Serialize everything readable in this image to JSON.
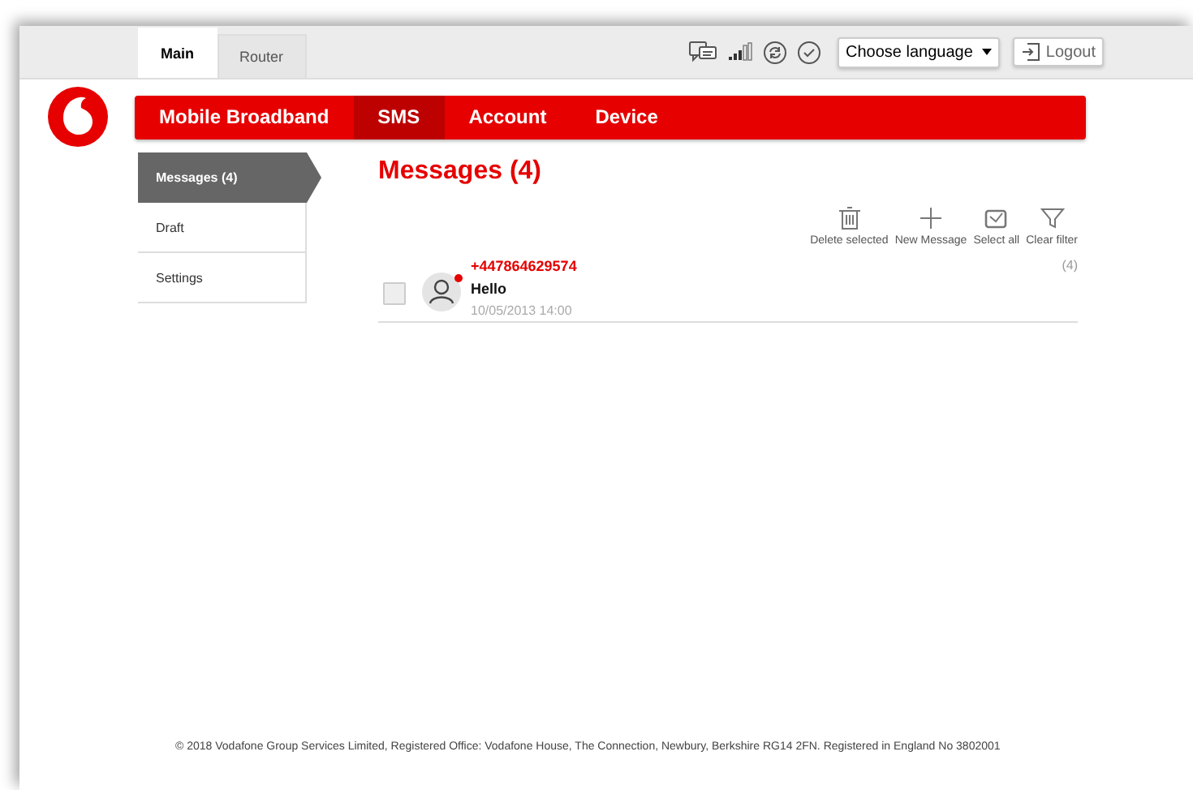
{
  "top_tabs": [
    {
      "label": "Main",
      "selected": true
    },
    {
      "label": "Router",
      "selected": false
    }
  ],
  "language_select": {
    "value": "Choose language"
  },
  "logout": "Logout",
  "nav": [
    {
      "label": "Mobile Broadband",
      "selected": false
    },
    {
      "label": "SMS",
      "selected": true
    },
    {
      "label": "Account",
      "selected": false
    },
    {
      "label": "Device",
      "selected": false
    }
  ],
  "sidebar": [
    {
      "label": "Messages (4)",
      "selected": true
    },
    {
      "label": "Draft",
      "selected": false
    },
    {
      "label": "Settings",
      "selected": false
    }
  ],
  "page_title": "Messages (4)",
  "toolbar": [
    {
      "kind": "delete",
      "label": "Delete selected"
    },
    {
      "kind": "new",
      "label": "New Message"
    },
    {
      "kind": "select",
      "label": "Select all"
    },
    {
      "kind": "filter",
      "label": "Clear filter"
    }
  ],
  "messages": [
    {
      "sender": "+447864629574",
      "text": "Hello",
      "time": "10/05/2013 14:00",
      "count": "(4)",
      "checked": false,
      "unread": true
    }
  ],
  "footer": "© 2018 Vodafone Group Services Limited, Registered Office: Vodafone House, The Connection, Newbury, Berkshire RG14 2FN. Registered in England No 3802001"
}
